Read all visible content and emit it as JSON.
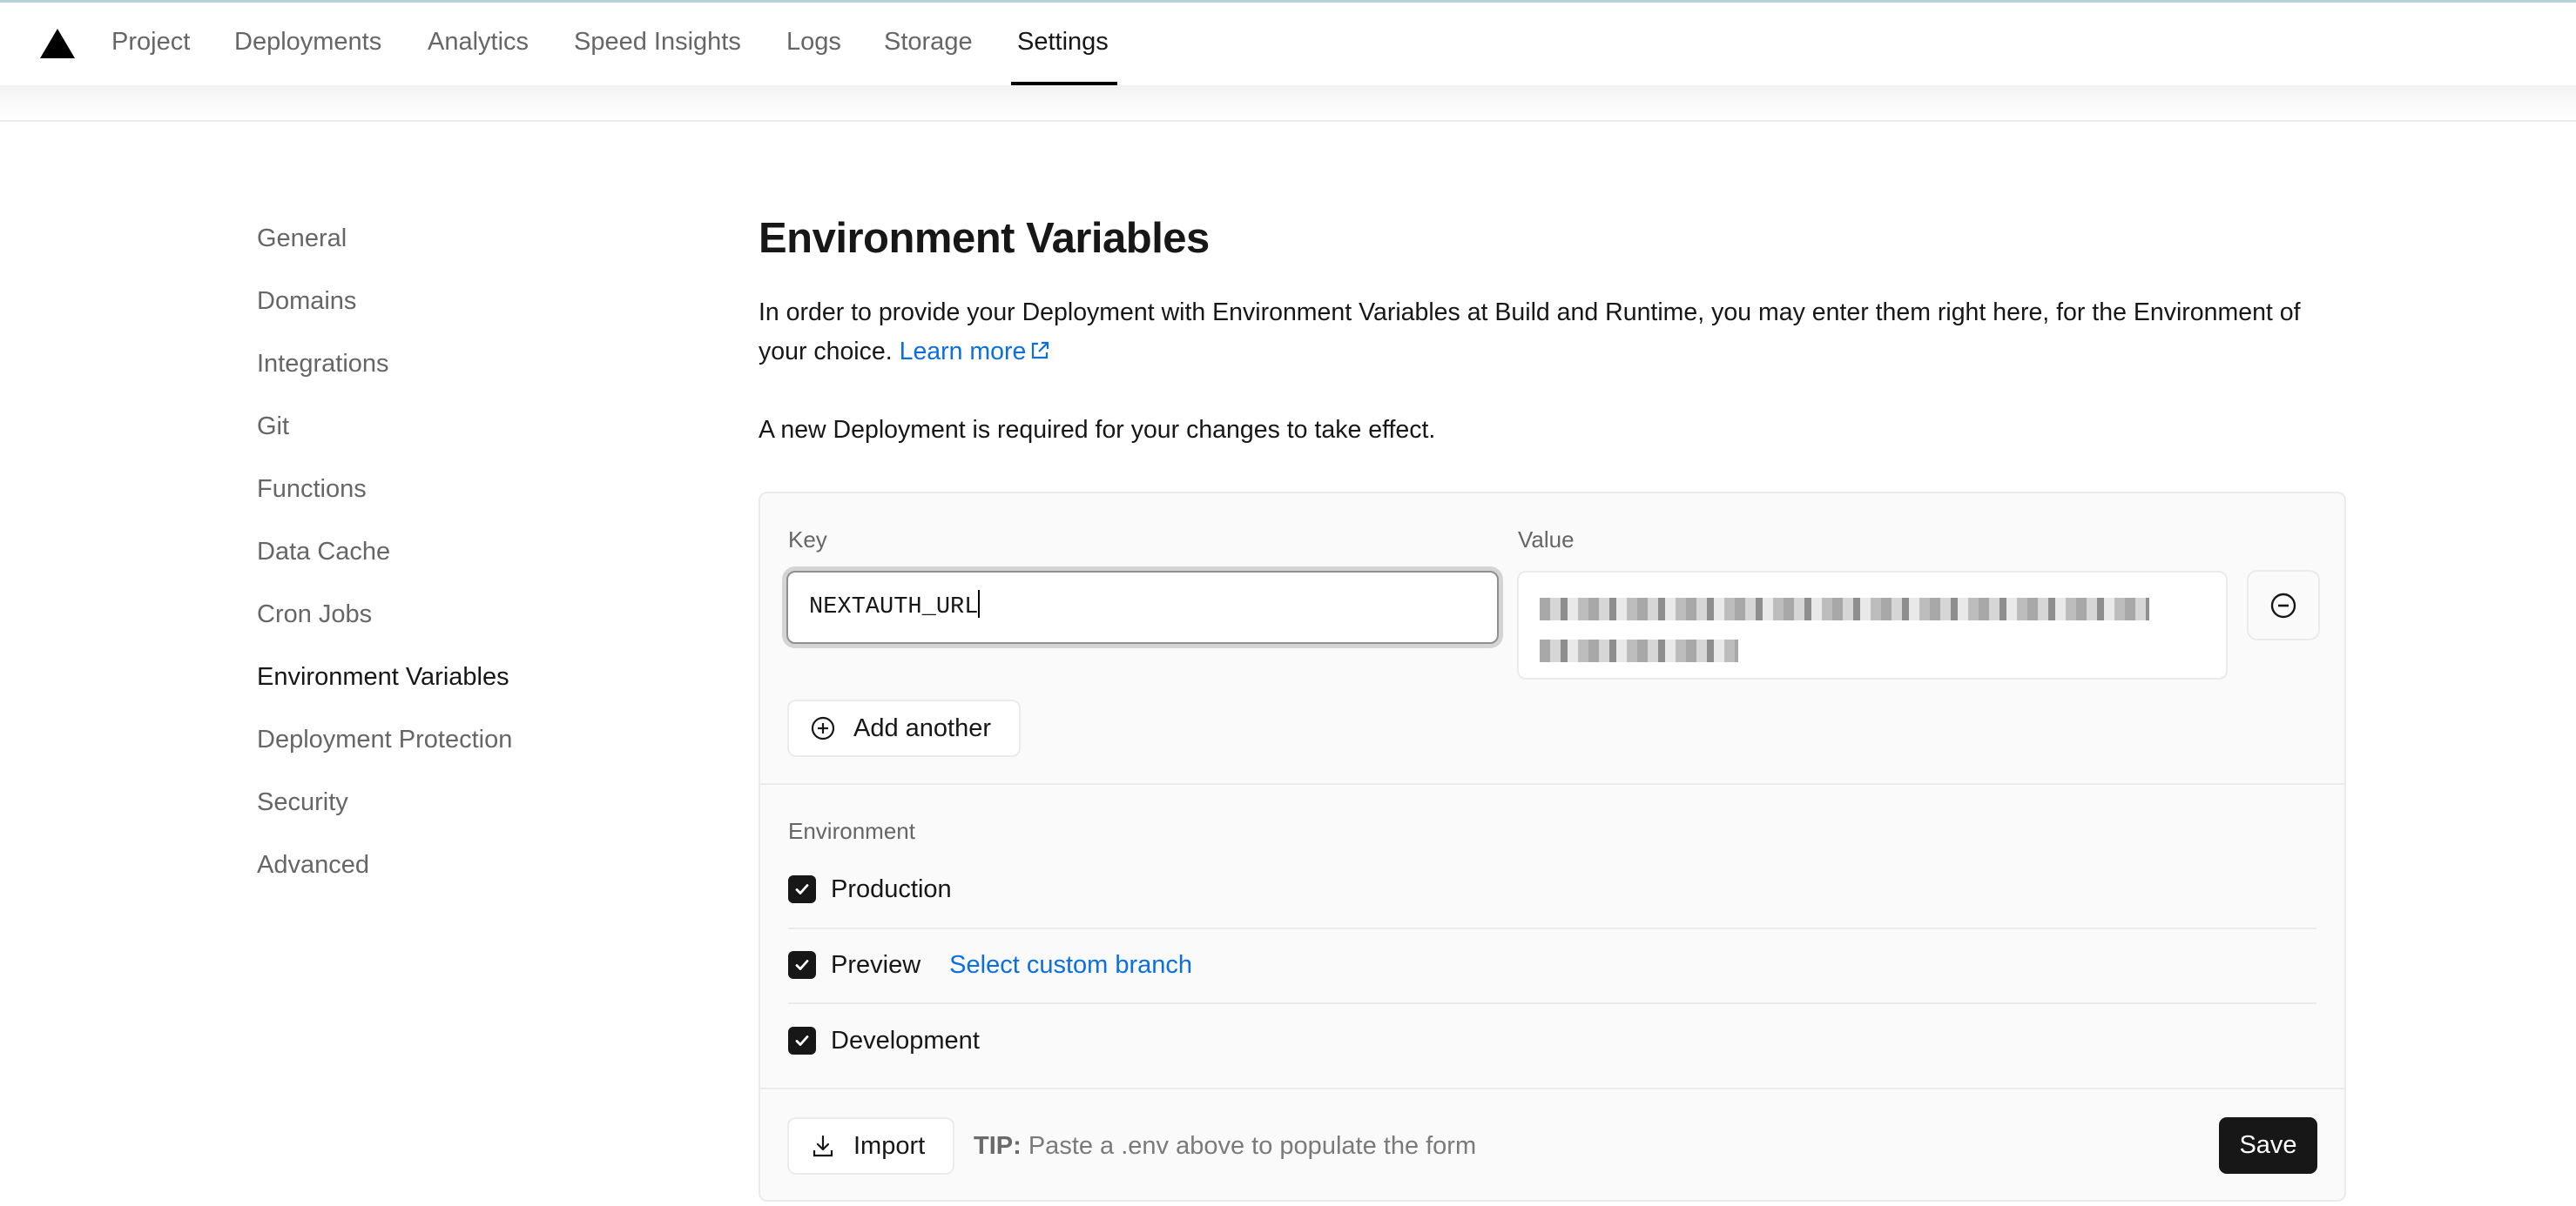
{
  "top_nav": {
    "logo": "vercel-triangle-logo",
    "items": [
      {
        "label": "Project",
        "active": false
      },
      {
        "label": "Deployments",
        "active": false
      },
      {
        "label": "Analytics",
        "active": false
      },
      {
        "label": "Speed Insights",
        "active": false
      },
      {
        "label": "Logs",
        "active": false
      },
      {
        "label": "Storage",
        "active": false
      },
      {
        "label": "Settings",
        "active": true
      }
    ]
  },
  "sidebar": {
    "items": [
      {
        "label": "General",
        "active": false
      },
      {
        "label": "Domains",
        "active": false
      },
      {
        "label": "Integrations",
        "active": false
      },
      {
        "label": "Git",
        "active": false
      },
      {
        "label": "Functions",
        "active": false
      },
      {
        "label": "Data Cache",
        "active": false
      },
      {
        "label": "Cron Jobs",
        "active": false
      },
      {
        "label": "Environment Variables",
        "active": true
      },
      {
        "label": "Deployment Protection",
        "active": false
      },
      {
        "label": "Security",
        "active": false
      },
      {
        "label": "Advanced",
        "active": false
      }
    ]
  },
  "main": {
    "title": "Environment Variables",
    "description": "In order to provide your Deployment with Environment Variables at Build and Runtime, you may enter them right here, for the Environment of your choice.",
    "learn_more": "Learn more",
    "notice": "A new Deployment is required for your changes to take effect.",
    "form": {
      "key_label": "Key",
      "key_value": "NEXTAUTH_URL",
      "value_label": "Value",
      "value_redacted": true,
      "add_another": "Add another",
      "environment_label": "Environment",
      "environments": [
        {
          "label": "Production",
          "checked": true
        },
        {
          "label": "Preview",
          "checked": true,
          "link": "Select custom branch"
        },
        {
          "label": "Development",
          "checked": true
        }
      ],
      "import_label": "Import",
      "tip_prefix": "TIP:",
      "tip_text": "Paste a .env above to populate the form",
      "save_label": "Save"
    }
  },
  "colors": {
    "accent_link": "#0a6fe0",
    "primary_button": "#171717",
    "muted_text": "#666666"
  }
}
